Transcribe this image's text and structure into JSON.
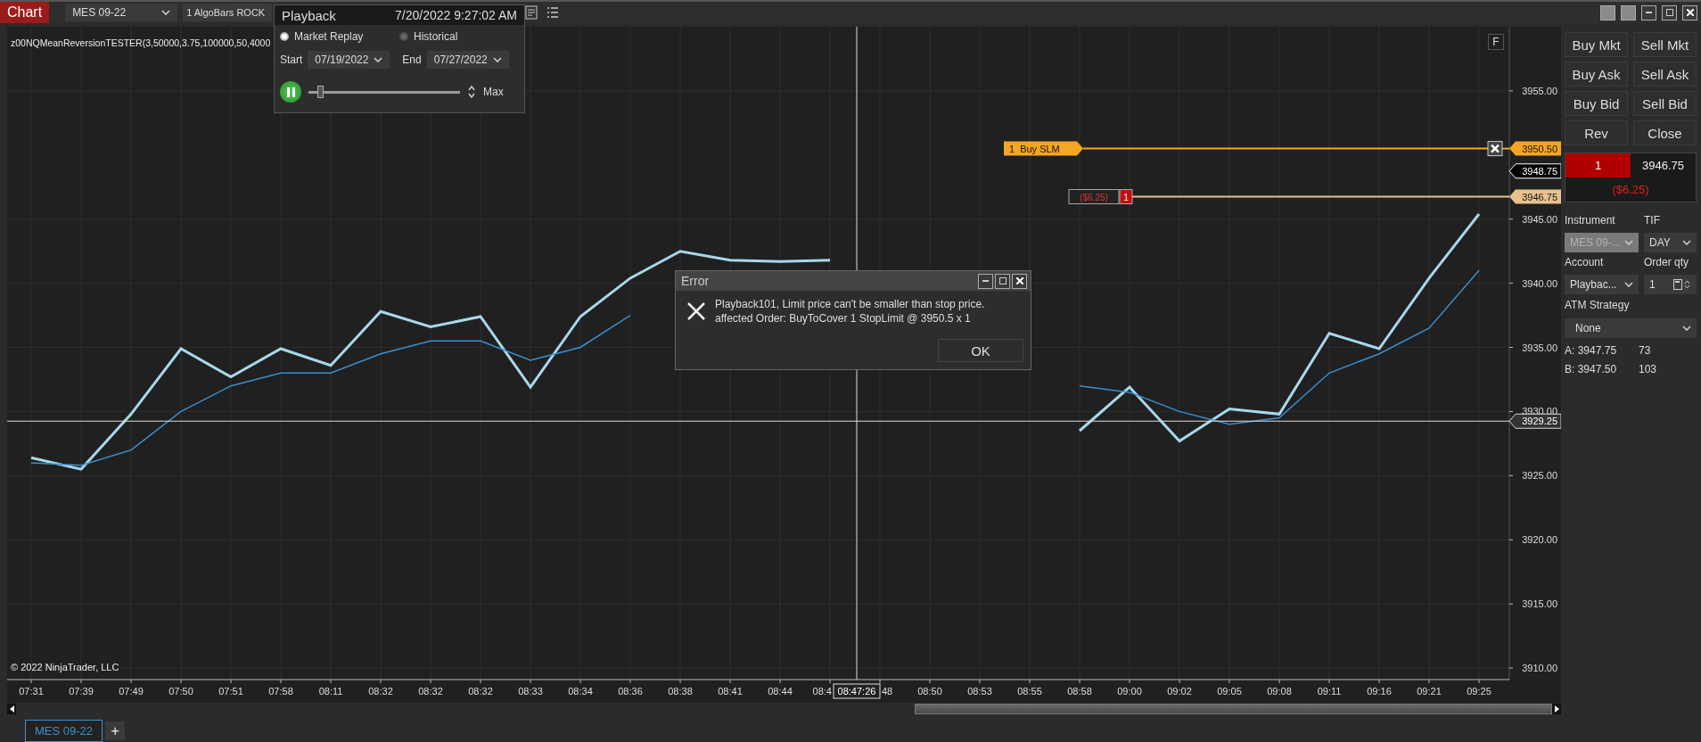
{
  "top_bar": {
    "tab": "Chart",
    "instrument": "MES 09-22",
    "bars": "1 AlgoBars ROCK"
  },
  "playback": {
    "title": "Playback",
    "time": "7/20/2022 9:27:02 AM",
    "modes": [
      {
        "label": "Market Replay",
        "selected": true
      },
      {
        "label": "Historical",
        "selected": false
      }
    ],
    "start": {
      "label": "Start",
      "value": "07/19/2022"
    },
    "end": {
      "label": "End",
      "value": "07/27/2022"
    },
    "playing": true,
    "speed": {
      "level": 0.06
    },
    "max": "Max"
  },
  "chart": {
    "indicator": "z00NQMeanReversionTESTER(3,50000,3.75,100000,50,4000",
    "f_button": "F",
    "copyright": "© 2022 NinjaTrader, LLC",
    "chart_data": {
      "type": "line",
      "grid": true,
      "categories": [
        "07:31",
        "07:39",
        "07:49",
        "07:50",
        "07:51",
        "07:58",
        "08:11",
        "08:32",
        "08:32",
        "08:32",
        "08:33",
        "08:34",
        "08:36",
        "08:38",
        "08:41",
        "08:44",
        "08:4",
        "48",
        "08:50",
        "08:53",
        "08:55",
        "08:58",
        "09:00",
        "09:02",
        "09:05",
        "09:08",
        "09:11",
        "09:16",
        "09:21",
        "09:25"
      ],
      "series": [
        {
          "color": "#a8d8ea",
          "values": [
            3926.4,
            3925.5,
            3929.8,
            3934.9,
            3932.7,
            3934.9,
            3933.6,
            3937.8,
            3936.6,
            3937.4,
            3931.9,
            3937.4,
            3940.4,
            3942.5,
            3941.8,
            3941.7,
            3941.8,
            null,
            null,
            null,
            null,
            3928.5,
            3931.9,
            3927.7,
            3930.2,
            3929.8,
            3936.1,
            3934.9,
            3940.4,
            3945.4
          ]
        },
        {
          "color": "#3a8fd0",
          "values": [
            3926,
            3925.8,
            3927,
            3930,
            3932,
            3933,
            3933,
            3934.5,
            3935.5,
            3935.5,
            3934,
            3935,
            3937.5,
            null,
            null,
            null,
            null,
            null,
            null,
            null,
            null,
            3932,
            3931.5,
            3930,
            3929,
            3929.5,
            3933,
            3934.5,
            3936.5,
            3941
          ]
        }
      ],
      "ylim": [
        3909.1,
        3960
      ],
      "yticks": [
        {
          "value": 3955,
          "label": "3955.00"
        },
        {
          "value": 3945,
          "label": "3945.00"
        },
        {
          "value": 3940,
          "label": "3940.00"
        },
        {
          "value": 3935,
          "label": "3935.00"
        },
        {
          "value": 3930,
          "label": "3930.00"
        },
        {
          "value": 3925,
          "label": "3925.00"
        },
        {
          "value": 3920,
          "label": "3920.00"
        },
        {
          "value": 3915,
          "label": "3915.00"
        },
        {
          "value": 3910,
          "label": "3910.00"
        }
      ]
    },
    "trading": {
      "order": {
        "quantity": "1",
        "text": "Buy SLM",
        "price": "3950.50"
      },
      "last_price": "3948.75",
      "position": {
        "pnl": "($6.25)",
        "quantity": "1",
        "price": "3946.75"
      },
      "crosshair": {
        "time": "08:47:26",
        "price": "3929.25"
      }
    }
  },
  "error_dialog": {
    "title": "Error",
    "lines": [
      "Playback101, Limit price can't be smaller than stop price.",
      "affected Order: BuyToCover 1 StopLimit @ 3950.5 x 1"
    ],
    "button": "OK"
  },
  "order_panel": {
    "buttons": [
      "Buy Mkt",
      "Sell Mkt",
      "Buy Ask",
      "Sell Ask",
      "Buy Bid",
      "Sell Bid",
      "Rev",
      "Close"
    ],
    "position": {
      "quantity": "1",
      "price": "3946.75",
      "pnl": "($6.25)"
    },
    "instrument": {
      "label": "Instrument",
      "value": "MES 09-...",
      "disabled": true
    },
    "tif": {
      "label": "TIF",
      "value": "DAY"
    },
    "account": {
      "label": "Account",
      "value": "Playbac..."
    },
    "order_qty": {
      "label": "Order qty",
      "value": "1"
    },
    "atm": {
      "label": "ATM Strategy",
      "value": "None"
    },
    "quotes": [
      {
        "side": "A:",
        "price": "3947.75",
        "size": "73"
      },
      {
        "side": "B:",
        "price": "3947.50",
        "size": "103"
      }
    ]
  },
  "tabs": [
    {
      "label": "MES 09-22",
      "selected": true
    }
  ],
  "add_tab": "+"
}
